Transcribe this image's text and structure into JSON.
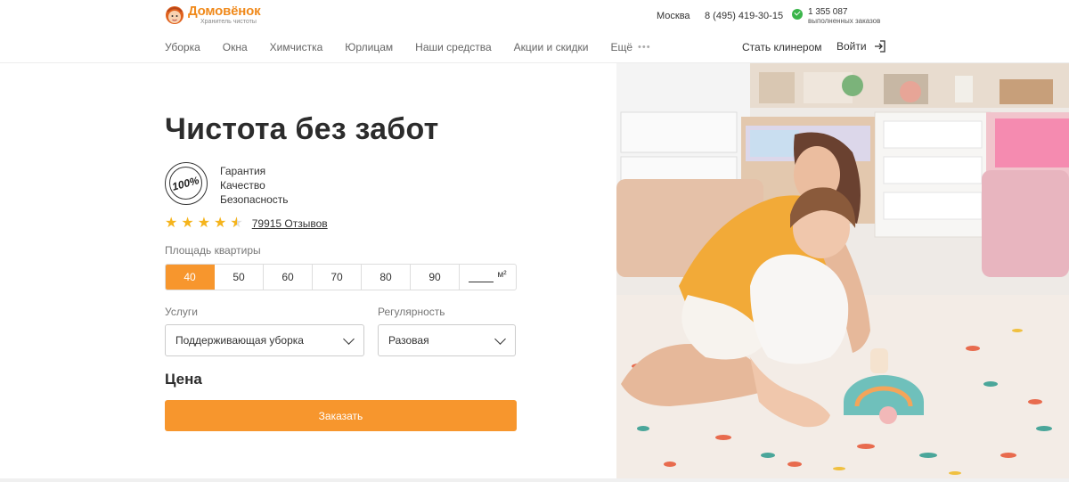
{
  "header": {
    "logo_name": "Домовёнок",
    "logo_tagline": "Хранитель чистоты",
    "city": "Москва",
    "phone": "8 (495) 419-30-15",
    "orders_count": "1 355 087",
    "orders_label": "выполненных заказов",
    "nav": [
      "Уборка",
      "Окна",
      "Химчистка",
      "Юрлицам",
      "Наши средства",
      "Акции и скидки"
    ],
    "nav_more": "Ещё",
    "become_cleaner": "Стать клинером",
    "login": "Войти"
  },
  "hero": {
    "title": "Чистота без забот",
    "badge_text": "100%",
    "guarantees": [
      "Гарантия",
      "Качество",
      "Безопасность"
    ],
    "rating": 4.5,
    "reviews": "79915 Отзывов"
  },
  "form": {
    "area_label": "Площадь квартиры",
    "area_options": [
      "40",
      "50",
      "60",
      "70",
      "80",
      "90"
    ],
    "area_selected": "40",
    "area_unit": "м²",
    "services_label": "Услуги",
    "services_value": "Поддерживающая уборка",
    "regularity_label": "Регулярность",
    "regularity_value": "Разовая",
    "price_label": "Цена",
    "order_button": "Заказать"
  },
  "colors": {
    "brand": "#f7962d",
    "star": "#f5b41c",
    "check": "#3ab54a"
  }
}
